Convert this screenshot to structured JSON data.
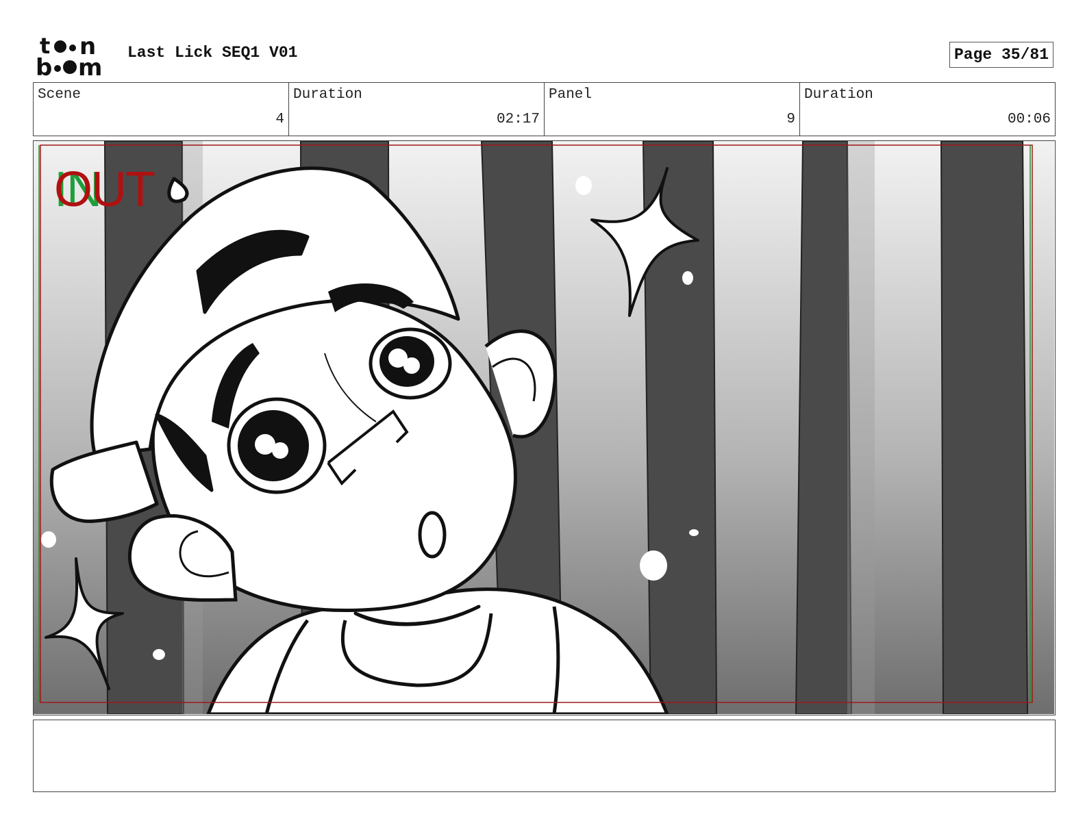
{
  "header": {
    "logo_text": "toonboom",
    "title": "Last Lick SEQ1 V01",
    "page_label": "Page 35/81"
  },
  "info": {
    "scene_label": "Scene",
    "scene_value": "4",
    "scene_duration_label": "Duration",
    "scene_duration_value": "02:17",
    "panel_label": "Panel",
    "panel_value": "9",
    "panel_duration_label": "Duration",
    "panel_duration_value": "00:06"
  },
  "panel": {
    "in_marker": "IN",
    "out_marker": "OUT",
    "in_color": "#1e9e3a",
    "out_color": "#b01010",
    "safe_frame_color": "#a01818"
  },
  "notes": {
    "text": ""
  }
}
